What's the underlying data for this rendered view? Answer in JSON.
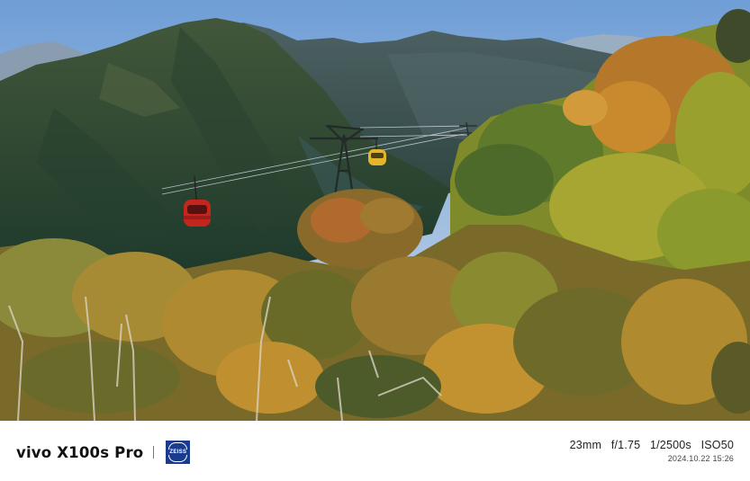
{
  "watermark": {
    "device": "vivo X100s Pro",
    "lens_brand": "ZEISS",
    "exif": {
      "focal_length": "23mm",
      "aperture": "f/1.75",
      "shutter": "1/2500s",
      "iso": "ISO50"
    },
    "datetime": "2024.10.22 15:26"
  },
  "colors": {
    "sky_top": "#6f9ed6",
    "sky_bottom": "#cfdcea",
    "mountain_far": "#8ea2b8",
    "mountain_mid": "#3d5356",
    "mountain_near": "#2c4a34",
    "foliage_autumn": "#c8972a",
    "foliage_green": "#7f9a2e",
    "cable_car": "#c4261e",
    "zeiss_blue": "#1b3c8e"
  }
}
